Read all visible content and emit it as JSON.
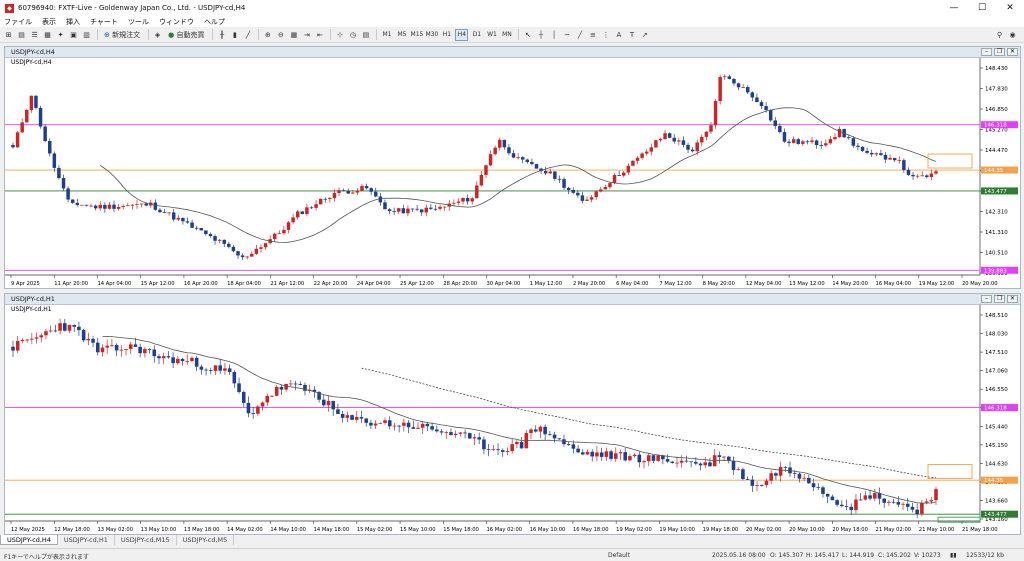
{
  "window": {
    "title": "60796940: FXTF-Live - Goldenway Japan Co., Ltd. - USDJPY-cd,H4",
    "min": "—",
    "max": "☐",
    "close": "✕"
  },
  "menu": [
    "ファイル",
    "表示",
    "挿入",
    "チャート",
    "ツール",
    "ウィンドウ",
    "ヘルプ"
  ],
  "toolbar": {
    "new_order": "新規注文",
    "auto_trade": "自動売買",
    "timeframes": [
      "M1",
      "M5",
      "M15",
      "M30",
      "H1",
      "H4",
      "D1",
      "W1",
      "MN"
    ],
    "active_tf": "H4"
  },
  "colors": {
    "accent": "#1e5fb3",
    "bull": "#c62828",
    "bear": "#1f3f8a",
    "magenta": "#e040fb",
    "orange": "#f5a04a",
    "green": "#2e7d32",
    "ma": "#555555"
  },
  "chart_data": [
    {
      "type": "candlestick",
      "title": "USDJPY-cd,H4",
      "ymin": 139.9,
      "ymax": 148.8,
      "ticks": [
        "148.430",
        "147.830",
        "146.850",
        "145.270",
        "144.470",
        "143.470",
        "142.890",
        "142.310",
        "141.310",
        "140.510",
        "139.920"
      ],
      "hlines": [
        {
          "name": "magenta-line",
          "value": 146.3,
          "label": "146.318"
        },
        {
          "name": "orange-line",
          "value": 144.37,
          "label": "144.35"
        },
        {
          "name": "green-line",
          "value": 143.48,
          "label": "143.477"
        },
        {
          "name": "magenta-low-line",
          "value": 140.1,
          "label": "139.883"
        }
      ],
      "xlabels": [
        "9 Apr 2025",
        "11 Apr 20:00",
        "14 Apr 04:00",
        "15 Apr 12:00",
        "16 Apr 20:00",
        "18 Apr 04:00",
        "21 Apr 12:00",
        "22 Apr 20:00",
        "24 Apr 04:00",
        "25 Apr 12:00",
        "28 Apr 20:00",
        "30 Apr 04:00",
        "1 May 12:00",
        "2 May 20:00",
        "6 May 04:00",
        "7 May 12:00",
        "8 May 20:00",
        "12 May 04:00",
        "13 May 12:00",
        "14 May 20:00",
        "16 May 04:00",
        "19 May 12:00",
        "20 May 20:00"
      ],
      "keypoints": [
        [
          0,
          145.3
        ],
        [
          4,
          147.6
        ],
        [
          8,
          145.0
        ],
        [
          12,
          143.0
        ],
        [
          18,
          142.8
        ],
        [
          30,
          142.9
        ],
        [
          45,
          141.3
        ],
        [
          50,
          140.6
        ],
        [
          58,
          141.7
        ],
        [
          62,
          142.5
        ],
        [
          70,
          143.4
        ],
        [
          77,
          143.6
        ],
        [
          82,
          142.6
        ],
        [
          92,
          142.7
        ],
        [
          100,
          143.2
        ],
        [
          104,
          145.1
        ],
        [
          106,
          145.6
        ],
        [
          110,
          144.8
        ],
        [
          118,
          144.1
        ],
        [
          124,
          143.0
        ],
        [
          130,
          143.9
        ],
        [
          137,
          145.0
        ],
        [
          142,
          145.9
        ],
        [
          148,
          145.2
        ],
        [
          152,
          146.2
        ],
        [
          154,
          148.4
        ],
        [
          158,
          148.0
        ],
        [
          163,
          147.2
        ],
        [
          168,
          145.6
        ],
        [
          176,
          145.5
        ],
        [
          180,
          146.0
        ],
        [
          186,
          145.0
        ],
        [
          192,
          144.9
        ],
        [
          196,
          144.0
        ],
        [
          201,
          144.2
        ]
      ],
      "candles": 202,
      "seed": 11,
      "ma_period": 20,
      "ma2_period": 0
    },
    {
      "type": "candlestick",
      "title": "USDJPY-cd,H1",
      "ymin": 143.3,
      "ymax": 148.8,
      "ticks": [
        "148.510",
        "148.030",
        "147.510",
        "147.060",
        "146.550",
        "146.050",
        "145.440",
        "145.150",
        "144.630",
        "144.100",
        "143.660",
        "143.160"
      ],
      "hlines": [
        {
          "name": "magenta-line",
          "value": 146.3,
          "label": "146.318"
        },
        {
          "name": "orange-line",
          "value": 144.38,
          "label": "144.35"
        },
        {
          "name": "green-line",
          "value": 143.48,
          "label": "143.477"
        }
      ],
      "xlabels": [
        "12 May 2025",
        "12 May 18:00",
        "13 May 02:00",
        "13 May 10:00",
        "13 May 18:00",
        "14 May 02:00",
        "14 May 10:00",
        "14 May 18:00",
        "15 May 02:00",
        "15 May 10:00",
        "15 May 18:00",
        "16 May 02:00",
        "16 May 10:00",
        "16 May 18:00",
        "19 May 02:00",
        "19 May 10:00",
        "19 May 18:00",
        "20 May 02:00",
        "20 May 10:00",
        "20 May 18:00",
        "21 May 02:00",
        "21 May 10:00",
        "21 May 18:00"
      ],
      "keypoints": [
        [
          0,
          147.9
        ],
        [
          6,
          148.2
        ],
        [
          10,
          148.5
        ],
        [
          14,
          148.3
        ],
        [
          18,
          147.8
        ],
        [
          26,
          147.9
        ],
        [
          32,
          147.6
        ],
        [
          38,
          147.5
        ],
        [
          46,
          147.2
        ],
        [
          50,
          146.1
        ],
        [
          54,
          146.6
        ],
        [
          58,
          146.9
        ],
        [
          64,
          146.7
        ],
        [
          70,
          146.0
        ],
        [
          78,
          145.9
        ],
        [
          86,
          145.8
        ],
        [
          94,
          145.6
        ],
        [
          102,
          145.2
        ],
        [
          108,
          145.3
        ],
        [
          110,
          145.8
        ],
        [
          114,
          145.6
        ],
        [
          120,
          145.1
        ],
        [
          130,
          145.0
        ],
        [
          140,
          144.9
        ],
        [
          148,
          144.8
        ],
        [
          150,
          145.1
        ],
        [
          154,
          144.6
        ],
        [
          158,
          144.2
        ],
        [
          163,
          144.7
        ],
        [
          168,
          144.5
        ],
        [
          174,
          143.9
        ],
        [
          178,
          143.7
        ],
        [
          182,
          144.0
        ],
        [
          187,
          143.8
        ],
        [
          192,
          143.6
        ],
        [
          196,
          144.1
        ]
      ],
      "candles": 197,
      "seed": 23,
      "ma_period": 20,
      "ma2_period": 75
    }
  ],
  "tabs": [
    "USDJPY-cd,H4",
    "USDJPY-cd,H1",
    "USDJPY-cd,M15",
    "USDJPY-cd,M5"
  ],
  "status": {
    "help": "F1キーでヘルプが表示されます",
    "profile": "Default",
    "datetime": "2025.05.16 08:00",
    "o": "O: 145.307",
    "h": "H: 145.417",
    "l": "L: 144.919",
    "c": "C: 145.202",
    "v": "V: 10273",
    "kb": "12533/12 kb"
  }
}
